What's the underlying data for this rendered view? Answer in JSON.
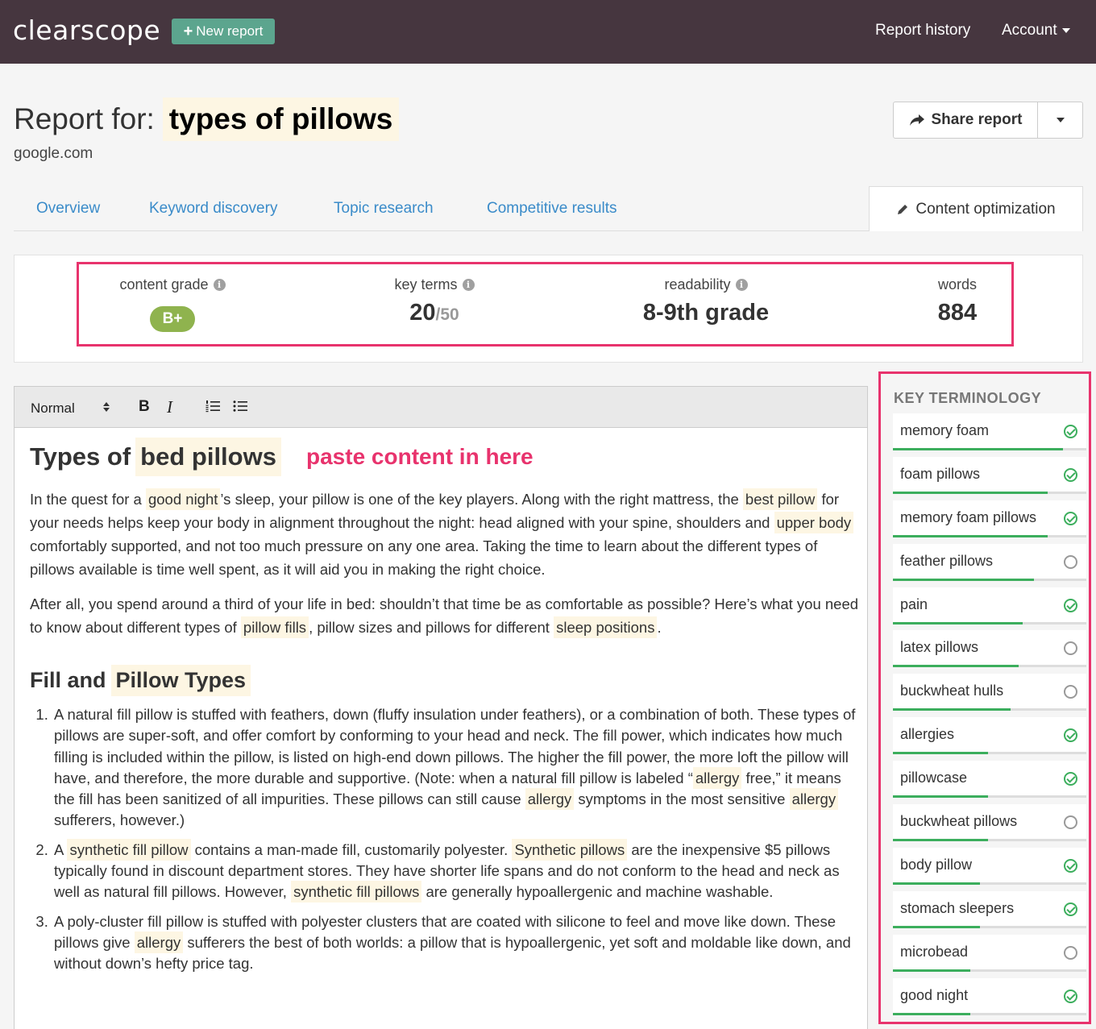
{
  "nav": {
    "logo": "clearscope",
    "new_report": "New report",
    "report_history": "Report history",
    "account": "Account"
  },
  "report": {
    "label": "Report for:",
    "keyword": "types of pillows",
    "domain": "google.com",
    "share_label": "Share report"
  },
  "tabs": [
    {
      "label": "Overview"
    },
    {
      "label": "Keyword discovery"
    },
    {
      "label": "Topic research"
    },
    {
      "label": "Competitive results"
    },
    {
      "label": "Content optimization",
      "active": true
    }
  ],
  "stats": {
    "content_grade_label": "content grade",
    "content_grade": "B+",
    "key_terms_label": "key terms",
    "key_terms_value": "20",
    "key_terms_total": "/50",
    "readability_label": "readability",
    "readability_value": "8-9th grade",
    "words_label": "words",
    "words_value": "884"
  },
  "toolbar": {
    "format": "Normal",
    "bold": "B",
    "italic": "I"
  },
  "editor": {
    "paste_hint": "paste content in here",
    "h1_pre": "Types of",
    "h1_hl": "bed pillows",
    "p1": {
      "a": "In the quest for a",
      "hl1": "good night",
      "b": "’s sleep, your pillow is one of the key players. Along with the right mattress, the",
      "hl2": "best pillow",
      "c": "for your needs helps keep your body in alignment throughout the night: head aligned with your spine, shoulders and",
      "hl3": "upper body",
      "d": "comfortably supported, and not too much pressure on any one area. Taking the time to learn about the different types of pillows available is time well spent, as it will aid you in making the right choice."
    },
    "p2": {
      "a": "After all, you spend around a third of your life in bed: shouldn’t that time be as comfortable as possible? Here’s what you need to know about different types of",
      "hl1": "pillow fills",
      "b": ", pillow sizes and pillows for different",
      "hl2": "sleep positions",
      "c": "."
    },
    "h2_pre": "Fill and",
    "h2_hl": "Pillow Types",
    "li1": {
      "a": "A natural fill pillow is stuffed with feathers, down (fluffy insulation under feathers), or a combination of both. These types of pillows are super-soft, and offer comfort by conforming to your head and neck. The fill power, which indicates how much filling is included within the pillow, is listed on high-end down pillows. The higher the fill power, the more loft the pillow will have, and therefore, the more durable and supportive. (Note: when a natural fill pillow is labeled “",
      "hl1": "allergy",
      "b": "free,” it means the fill has been sanitized of all impurities. These pillows can still cause",
      "hl2": "allergy",
      "c": "symptoms in the most sensitive",
      "hl3": "allergy",
      "d": "sufferers, however.)"
    },
    "li2": {
      "a": "A",
      "hl1": "synthetic fill pillow",
      "b": "contains a man-made fill, customarily polyester.",
      "hl2": "Synthetic pillows",
      "c": "are the inexpensive $5 pillows typically found in discount department stores. They have shorter life spans and do not conform to the head and neck as well as natural fill pillows. However,",
      "hl3": "synthetic fill pillows",
      "d": "are generally hypoallergenic and machine washable."
    },
    "li3": {
      "a": "A poly-cluster fill pillow is stuffed with polyester clusters that are coated with silicone to feel and move like down. These pillows give",
      "hl1": "allergy",
      "b": "sufferers the best of both worlds: a pillow that is hypoallergenic, yet soft and moldable like down, and without down’s hefty price tag."
    }
  },
  "key_terminology": {
    "title": "KEY TERMINOLOGY",
    "items": [
      {
        "label": "memory foam",
        "done": true,
        "progress": 0.88
      },
      {
        "label": "foam pillows",
        "done": true,
        "progress": 0.8
      },
      {
        "label": "memory foam pillows",
        "done": true,
        "progress": 0.8
      },
      {
        "label": "feather pillows",
        "done": false,
        "progress": 0.73
      },
      {
        "label": "pain",
        "done": true,
        "progress": 0.67
      },
      {
        "label": "latex pillows",
        "done": false,
        "progress": 0.65
      },
      {
        "label": "buckwheat hulls",
        "done": false,
        "progress": 0.61
      },
      {
        "label": "allergies",
        "done": true,
        "progress": 0.49
      },
      {
        "label": "pillowcase",
        "done": true,
        "progress": 0.49
      },
      {
        "label": "buckwheat pillows",
        "done": false,
        "progress": 0.49
      },
      {
        "label": "body pillow",
        "done": true,
        "progress": 0.45
      },
      {
        "label": "stomach sleepers",
        "done": true,
        "progress": 0.45
      },
      {
        "label": "microbead",
        "done": false,
        "progress": 0.4
      },
      {
        "label": "good night",
        "done": true,
        "progress": 0.4
      }
    ]
  },
  "colors": {
    "nav_bg": "#46363f",
    "accent_green": "#5ca58e",
    "highlight_border": "#e8336d",
    "link": "#3a8bc9",
    "check_green": "#3cae5d"
  }
}
